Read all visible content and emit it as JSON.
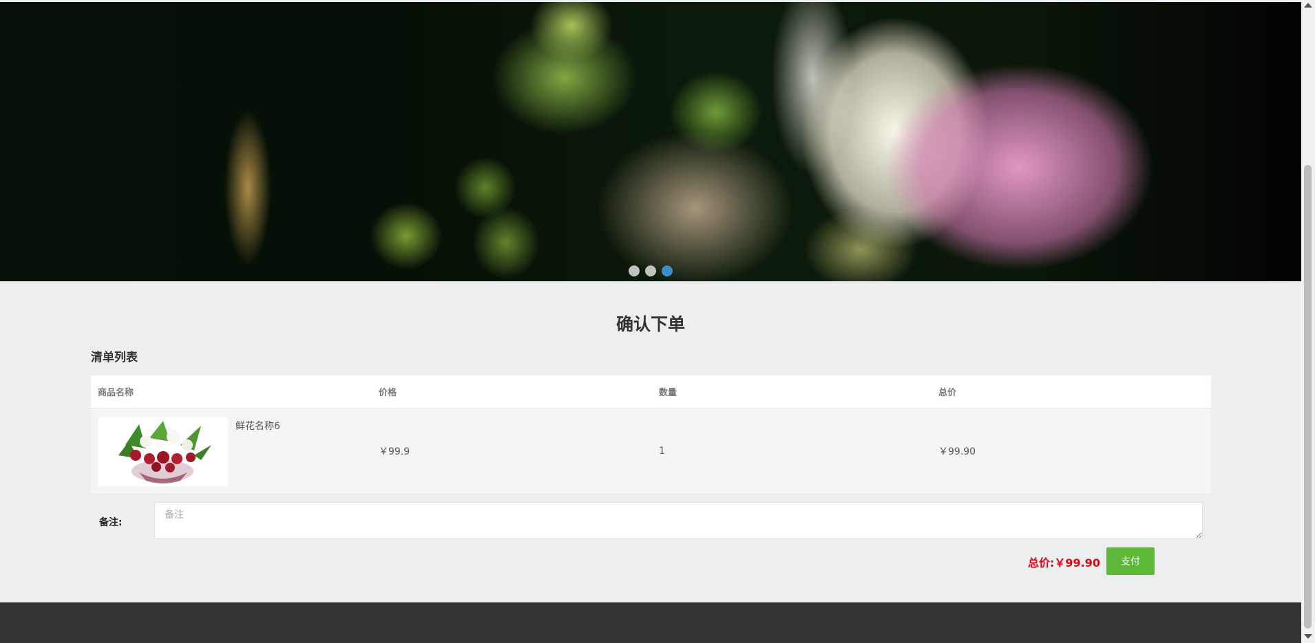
{
  "banner": {
    "image": "flower-photo",
    "slides": 3,
    "active_slide": 3
  },
  "page": {
    "title": "确认下单",
    "subtitle": "清单列表"
  },
  "table": {
    "headers": [
      "商品名称",
      "价格",
      "数量",
      "总价"
    ],
    "rows": [
      {
        "image": "bouquet-photo",
        "name": "鲜花名称6",
        "price": "￥99.9",
        "quantity": "1",
        "total": "￥99.90"
      }
    ]
  },
  "note": {
    "label": "备注:",
    "placeholder": "备注",
    "value": ""
  },
  "summary": {
    "total_label": "总价:",
    "total_value": "￥99.90",
    "pay_label": "支付"
  },
  "colors": {
    "accent_pay": "#5fb938",
    "total_red": "#e60012",
    "active_dot": "#3d8ccd",
    "footer": "#333333"
  }
}
